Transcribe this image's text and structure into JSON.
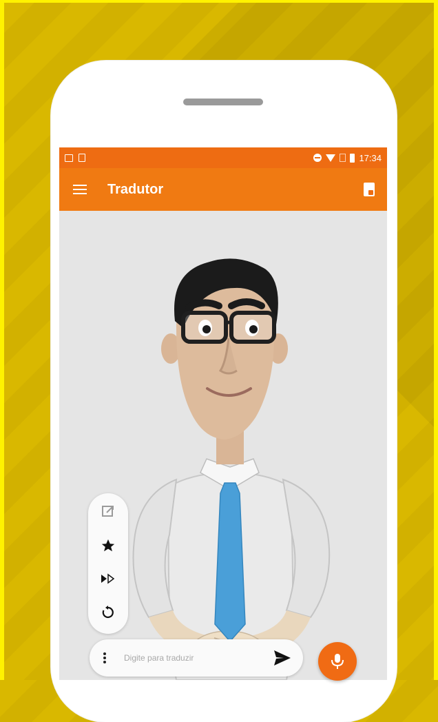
{
  "status_bar": {
    "time": "17:34",
    "left_icons": [
      "image-icon",
      "sim-card-icon"
    ],
    "right_icons": [
      "do-not-disturb-icon",
      "wifi-icon",
      "sim-icon",
      "battery-icon"
    ]
  },
  "app_bar": {
    "title": "Tradutor",
    "menu_icon": "hamburger-menu-icon",
    "action_icon": "dictionary-icon"
  },
  "colors": {
    "accent": "#f07a12",
    "status_bar": "#ee6c12",
    "background": "#d9b800",
    "frame": "#fff200"
  },
  "side_tools": [
    {
      "name": "open-external-icon"
    },
    {
      "name": "star-icon"
    },
    {
      "name": "speed-icon"
    },
    {
      "name": "replay-icon"
    }
  ],
  "input": {
    "placeholder": "Digite para traduzir",
    "send_icon": "send-icon",
    "more_icon": "more-vert-icon"
  },
  "mic_button": {
    "icon": "mic-icon"
  }
}
